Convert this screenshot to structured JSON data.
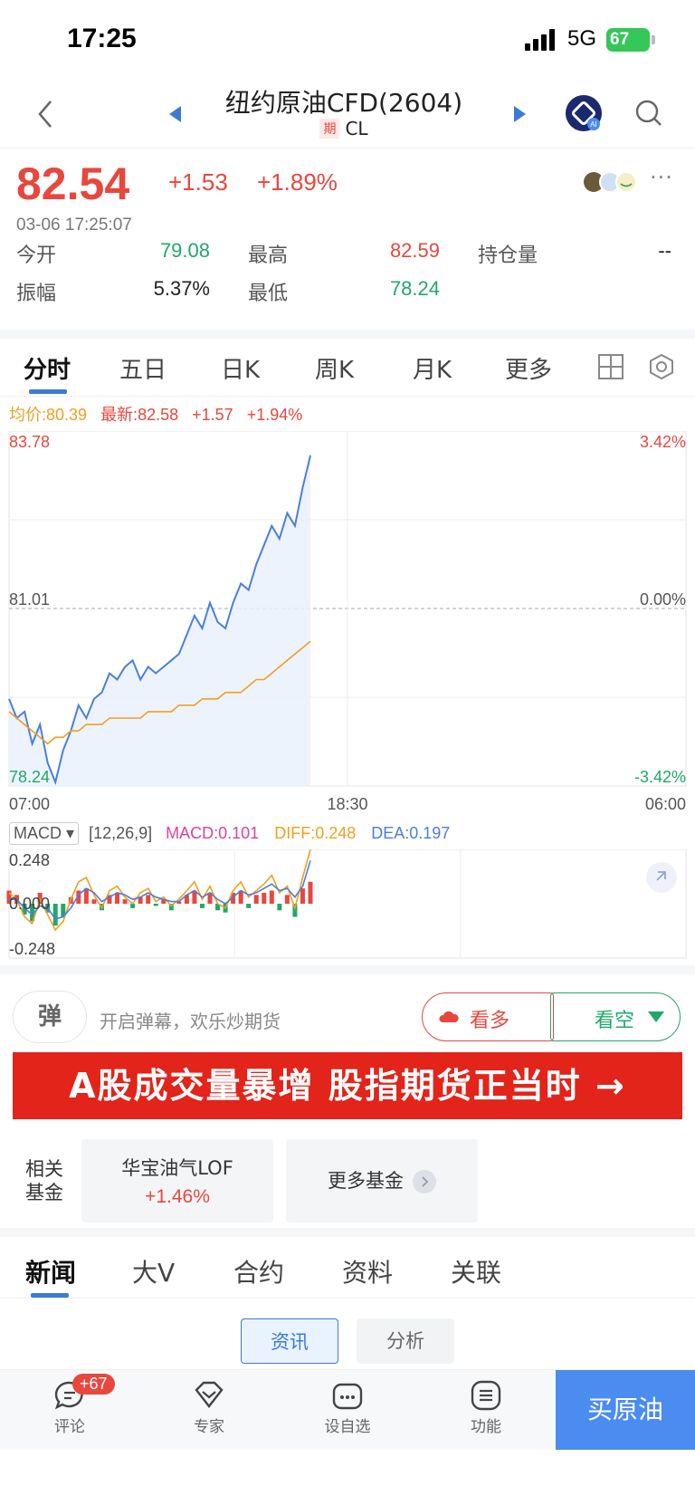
{
  "status": {
    "time": "17:25",
    "network": "5G",
    "battery": "67"
  },
  "nav": {
    "title": "纽约原油CFD(2604)",
    "tag": "期",
    "symbol": "CL"
  },
  "quote": {
    "price": "82.54",
    "change": "+1.53",
    "change_pct": "+1.89%",
    "timestamp": "03-06 17:25:07",
    "stats": [
      {
        "label": "今开",
        "value": "79.08",
        "color": "#20a86b"
      },
      {
        "label": "最高",
        "value": "82.59",
        "color": "#e8473e"
      },
      {
        "label": "持仓量",
        "value": "--",
        "color": "#222222"
      },
      {
        "label": "振幅",
        "value": "5.37%",
        "color": "#222222"
      },
      {
        "label": "最低",
        "value": "78.24",
        "color": "#20a86b"
      }
    ]
  },
  "tabs": [
    "分时",
    "五日",
    "日K",
    "周K",
    "月K",
    "更多"
  ],
  "chart_header": {
    "avg": "均价:80.39",
    "latest": "最新:82.58",
    "chg": "+1.57",
    "pct": "+1.94%"
  },
  "chart_data": [
    {
      "type": "line",
      "x_ticks": [
        "07:00",
        "18:30",
        "06:00"
      ],
      "y_left_ticks": [
        "83.78",
        "81.01",
        "78.24"
      ],
      "y_right_ticks": [
        "3.42%",
        "0.00%",
        "-3.42%"
      ],
      "ylim": [
        78.24,
        83.78
      ],
      "series": [
        {
          "name": "最新",
          "color": "#4a7fe0",
          "values": [
            79.6,
            79.3,
            79.4,
            78.9,
            79.2,
            78.6,
            78.3,
            78.8,
            79.1,
            79.5,
            79.3,
            79.6,
            79.7,
            80.0,
            79.9,
            80.1,
            80.2,
            79.9,
            80.1,
            80.0,
            80.1,
            80.2,
            80.3,
            80.6,
            80.9,
            80.7,
            81.1,
            80.8,
            80.7,
            81.1,
            81.4,
            81.3,
            81.7,
            82.0,
            82.3,
            82.1,
            82.5,
            82.3,
            82.9,
            83.4
          ]
        },
        {
          "name": "均价",
          "color": "#f0a020",
          "values": [
            79.4,
            79.3,
            79.2,
            79.1,
            79.0,
            78.9,
            79.0,
            79.0,
            79.1,
            79.1,
            79.2,
            79.2,
            79.2,
            79.3,
            79.3,
            79.3,
            79.3,
            79.3,
            79.4,
            79.4,
            79.4,
            79.4,
            79.5,
            79.5,
            79.5,
            79.6,
            79.6,
            79.6,
            79.7,
            79.7,
            79.7,
            79.8,
            79.9,
            79.9,
            80.0,
            80.1,
            80.2,
            80.3,
            80.4,
            80.5
          ]
        }
      ]
    },
    {
      "type": "bar",
      "title": "MACD",
      "params": "[12,26,9]",
      "macd": "MACD:0.101",
      "diff": "DIFF:0.248",
      "dea": "DEA:0.197",
      "y_ticks": [
        "0.248",
        "0.000",
        "-0.248"
      ],
      "ylim": [
        -0.248,
        0.248
      ],
      "values": [
        0.06,
        0.04,
        -0.05,
        -0.08,
        0.05,
        -0.04,
        -0.1,
        -0.06,
        0.03,
        0.06,
        0.07,
        0.02,
        -0.03,
        0.04,
        0.05,
        0.02,
        -0.02,
        0.03,
        0.04,
        -0.01,
        0.02,
        -0.03,
        0.01,
        0.04,
        0.06,
        -0.02,
        0.05,
        -0.03,
        -0.04,
        0.05,
        0.06,
        -0.02,
        0.04,
        0.05,
        0.06,
        -0.03,
        0.04,
        -0.06,
        0.07,
        0.1
      ],
      "diff_values": [
        0.05,
        0.02,
        -0.06,
        -0.09,
        0.02,
        -0.05,
        -0.12,
        -0.08,
        0.02,
        0.1,
        0.12,
        0.04,
        -0.02,
        0.06,
        0.08,
        0.03,
        0.0,
        0.05,
        0.07,
        0.01,
        0.03,
        -0.01,
        0.02,
        0.06,
        0.1,
        0.02,
        0.08,
        0.0,
        -0.02,
        0.06,
        0.1,
        0.03,
        0.06,
        0.09,
        0.13,
        0.05,
        0.08,
        -0.02,
        0.12,
        0.248
      ],
      "dea_values": [
        0.02,
        0.02,
        -0.02,
        -0.05,
        -0.01,
        -0.02,
        -0.07,
        -0.06,
        -0.02,
        0.04,
        0.07,
        0.05,
        0.01,
        0.03,
        0.05,
        0.04,
        0.02,
        0.03,
        0.05,
        0.03,
        0.02,
        0.01,
        0.01,
        0.04,
        0.06,
        0.03,
        0.05,
        0.02,
        0.0,
        0.03,
        0.06,
        0.04,
        0.05,
        0.07,
        0.09,
        0.06,
        0.07,
        0.03,
        0.08,
        0.197
      ]
    }
  ],
  "danmu": {
    "icon_text": "弹",
    "placeholder": "开启弹幕，欢乐炒期货",
    "bull": "看多",
    "bear": "看空"
  },
  "banner": {
    "text": "A股成交量暴增 股指期货正当时 →"
  },
  "funds": {
    "label": "相关基金",
    "name": "华宝油气LOF",
    "pct": "+1.46%",
    "more": "更多基金"
  },
  "news_tabs": [
    "新闻",
    "大V",
    "合约",
    "资料",
    "关联"
  ],
  "segments": [
    "资讯",
    "分析"
  ],
  "bottom": {
    "comment": "评论",
    "badge": "+67",
    "expert": "专家",
    "watch": "设自选",
    "func": "功能",
    "buy": "买原油"
  },
  "colors": {
    "up": "#e8473e",
    "down": "#20a86b",
    "accent": "#3a7bd5"
  }
}
